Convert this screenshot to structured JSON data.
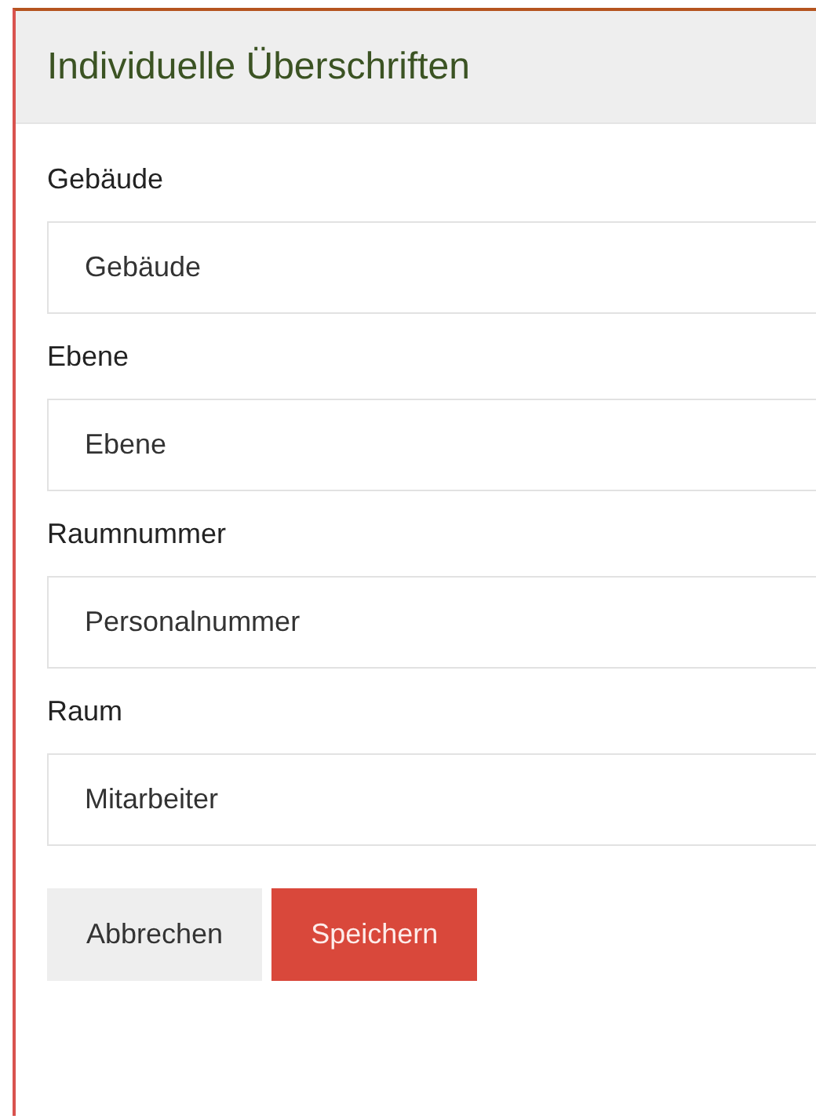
{
  "panel": {
    "title": "Individuelle Überschriften"
  },
  "fields": [
    {
      "label": "Gebäude",
      "value": "Gebäude"
    },
    {
      "label": "Ebene",
      "value": "Ebene"
    },
    {
      "label": "Raumnummer",
      "value": "Personalnummer"
    },
    {
      "label": "Raum",
      "value": "Mitarbeiter"
    }
  ],
  "buttons": [
    {
      "kind": "secondary",
      "label": "Abbrechen"
    },
    {
      "kind": "primary",
      "label": "Speichern"
    }
  ]
}
